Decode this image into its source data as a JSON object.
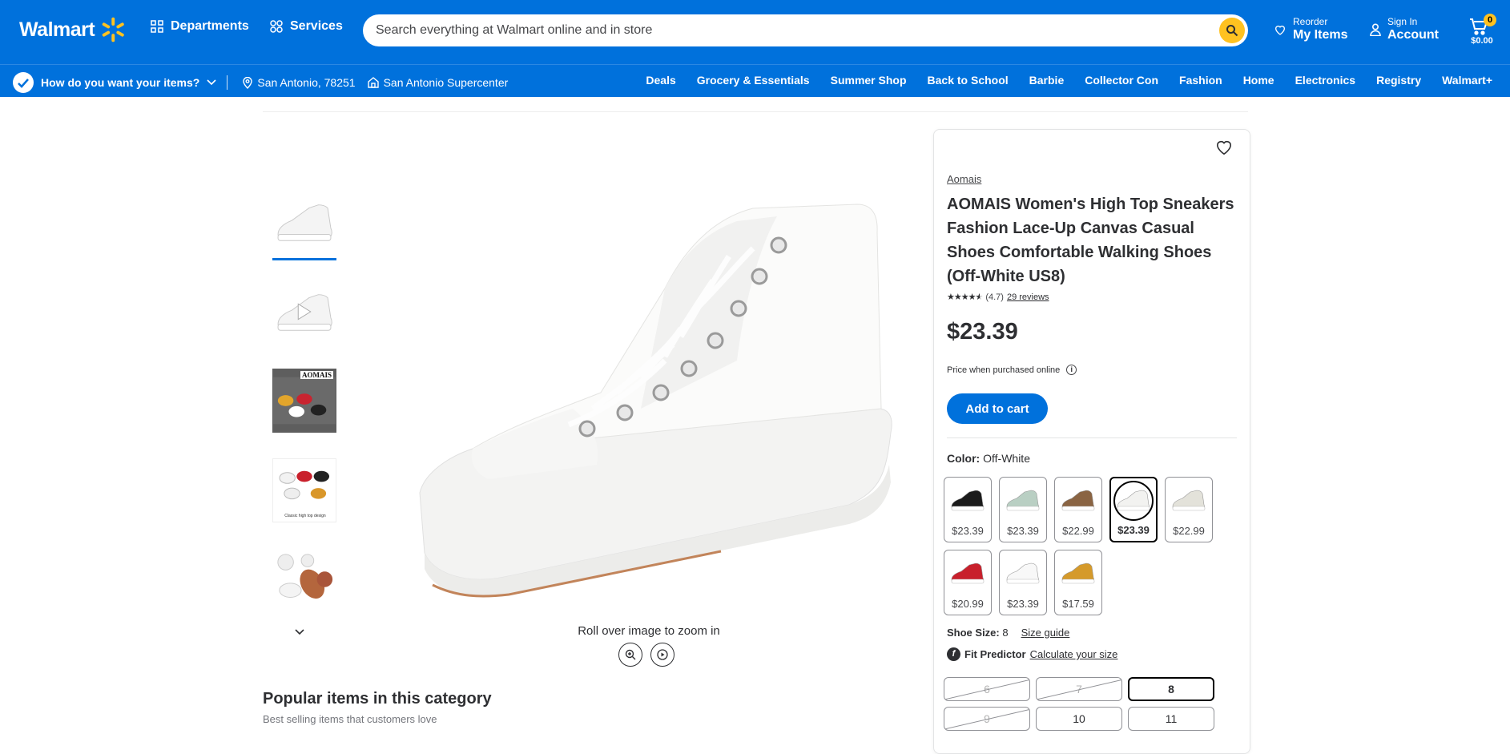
{
  "header": {
    "logo": "Walmart",
    "departments": "Departments",
    "services": "Services",
    "search_placeholder": "Search everything at Walmart online and in store",
    "reorder_small": "Reorder",
    "reorder_big": "My Items",
    "signin_small": "Sign In",
    "signin_big": "Account",
    "cart_count": "0",
    "cart_total": "$0.00"
  },
  "subbar": {
    "delivery_question": "How do you want your items?",
    "zip": "San Antonio, 78251",
    "store": "San Antonio Supercenter",
    "categories": [
      "Deals",
      "Grocery & Essentials",
      "Summer Shop",
      "Back to School",
      "Barbie",
      "Collector Con",
      "Fashion",
      "Home",
      "Electronics",
      "Registry",
      "Walmart+"
    ]
  },
  "gallery": {
    "zoom_hint": "Roll over image to zoom in",
    "thumbnails": [
      "shoe-side-view",
      "shoe-video",
      "colors-lineup",
      "classic-high-top-design",
      "shoe-sole-detail"
    ],
    "thumb_brand": "AOMAIS",
    "thumb_caption": "Classic high top design"
  },
  "popular": {
    "title": "Popular items in this category",
    "subtitle": "Best selling items that customers love"
  },
  "product": {
    "brand": "Aomais",
    "title": "AOMAIS Women's High Top Sneakers Fashion Lace-Up Canvas Casual Shoes Comfortable Walking Shoes (Off-White US8)",
    "rating": "(4.7)",
    "reviews": "29 reviews",
    "price": "$23.39",
    "price_note": "Price when purchased online",
    "add_to_cart": "Add to cart",
    "color_label": "Color:",
    "color_value": "Off-White",
    "colors": [
      {
        "name": "Black",
        "price": "$23.39",
        "fill": "#1b1b1b",
        "sole": "#ffffff"
      },
      {
        "name": "Mint",
        "price": "$23.39",
        "fill": "#b9cfc3",
        "sole": "#ffffff"
      },
      {
        "name": "Leopard",
        "price": "$22.99",
        "fill": "#8a6443",
        "sole": "#ffffff"
      },
      {
        "name": "Off-White",
        "price": "$23.39",
        "fill": "#f2f2f0",
        "sole": "#ffffff",
        "selected": true
      },
      {
        "name": "Beige",
        "price": "$22.99",
        "fill": "#e3e2da",
        "sole": "#ffffff"
      },
      {
        "name": "Red",
        "price": "$20.99",
        "fill": "#c8202c",
        "sole": "#ffffff"
      },
      {
        "name": "White",
        "price": "$23.39",
        "fill": "#f8f8f8",
        "sole": "#ffffff"
      },
      {
        "name": "Yellow",
        "price": "$17.59",
        "fill": "#d59a2b",
        "sole": "#ffffff"
      }
    ],
    "size_label": "Shoe Size:",
    "size_value": "8",
    "size_guide": "Size guide",
    "fit_predictor": "Fit Predictor",
    "calc_size": "Calculate your size",
    "sizes": [
      {
        "label": "6",
        "available": false
      },
      {
        "label": "7",
        "available": false
      },
      {
        "label": "8",
        "available": true,
        "selected": true
      },
      {
        "label": "9",
        "available": false
      },
      {
        "label": "10",
        "available": true
      },
      {
        "label": "11",
        "available": true
      }
    ]
  },
  "colors": {
    "brand_blue": "#0071dc",
    "spark_yellow": "#ffc220"
  }
}
